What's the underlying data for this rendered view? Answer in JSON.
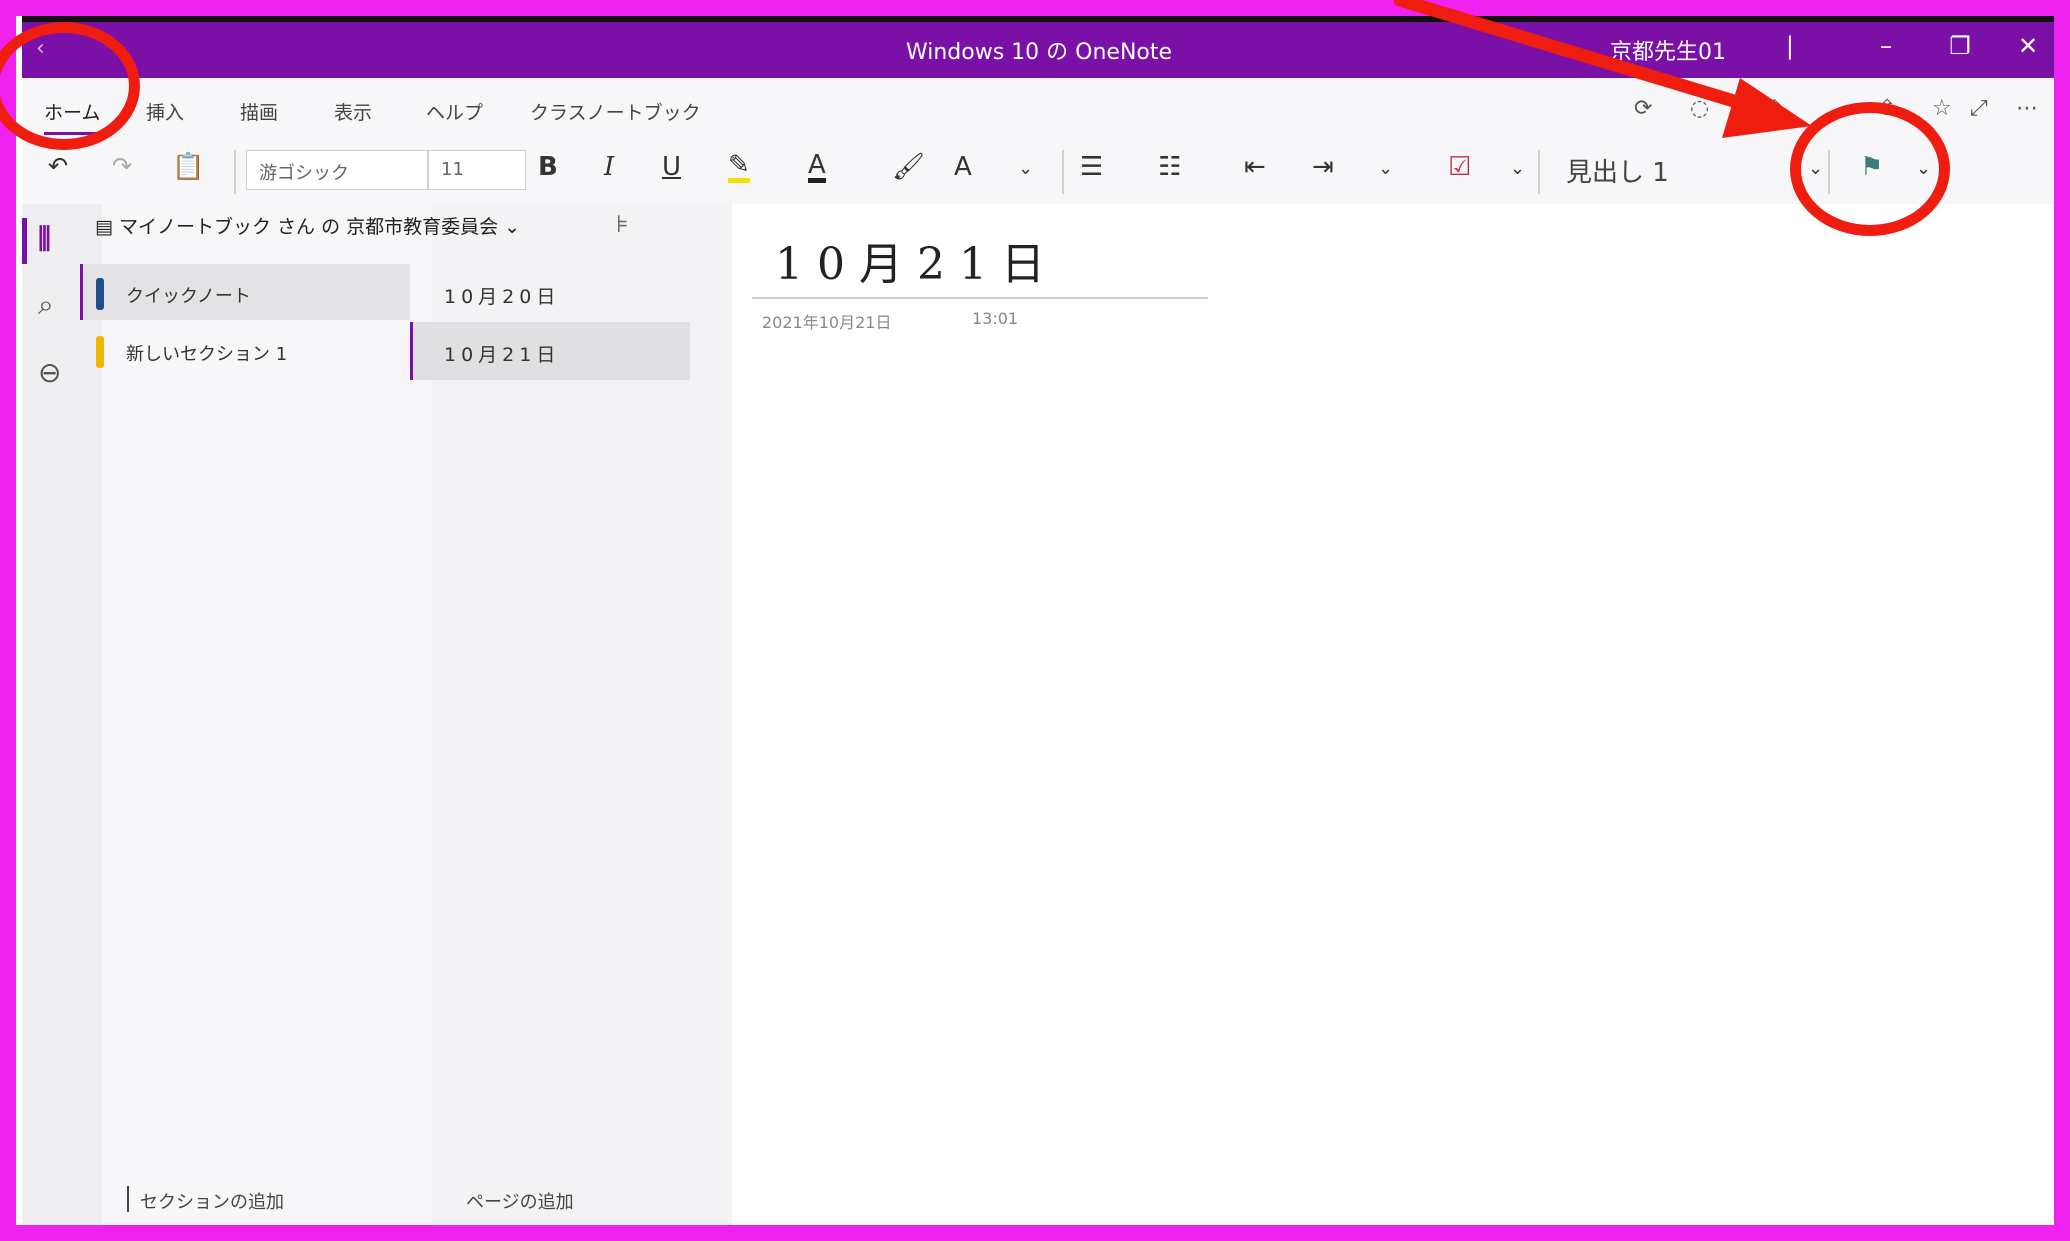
{
  "window": {
    "back_glyph": "‹",
    "forward_glyph": "›",
    "title": "Windows 10 の OneNote",
    "user": "京都先生01",
    "separator": "|",
    "minimize": "–",
    "maximize": "❐",
    "close": "✕"
  },
  "tabs": [
    {
      "label": "ホーム",
      "active": true
    },
    {
      "label": "挿入"
    },
    {
      "label": "描画"
    },
    {
      "label": "表示"
    },
    {
      "label": "ヘルプ"
    },
    {
      "label": "クラスノートブック"
    }
  ],
  "ribbon": {
    "font_name": "游ゴシック",
    "font_size": "11",
    "bold": "B",
    "italic": "I",
    "underline": "U",
    "heading_style": "見出し 1"
  },
  "sidebar": {
    "notebook_title": "マイノートブック さん の 京都市教育委員会",
    "sections": [
      {
        "label": "クイックノート",
        "color": "#1f4e8c",
        "selected": true
      },
      {
        "label": "新しいセクション 1",
        "color": "#f2b600",
        "selected": false
      }
    ],
    "pages": [
      {
        "label": "10月20日",
        "selected": false
      },
      {
        "label": "10月21日",
        "selected": true
      }
    ],
    "add_section": "セクションの追加",
    "add_page": "ページの追加"
  },
  "page": {
    "title": "10月21日",
    "date": "2021年10月21日",
    "time": "13:01"
  },
  "colors": {
    "titlebar": "#7a10a6",
    "annotation": "#ef1d0f",
    "frame": "#ee22ee"
  }
}
